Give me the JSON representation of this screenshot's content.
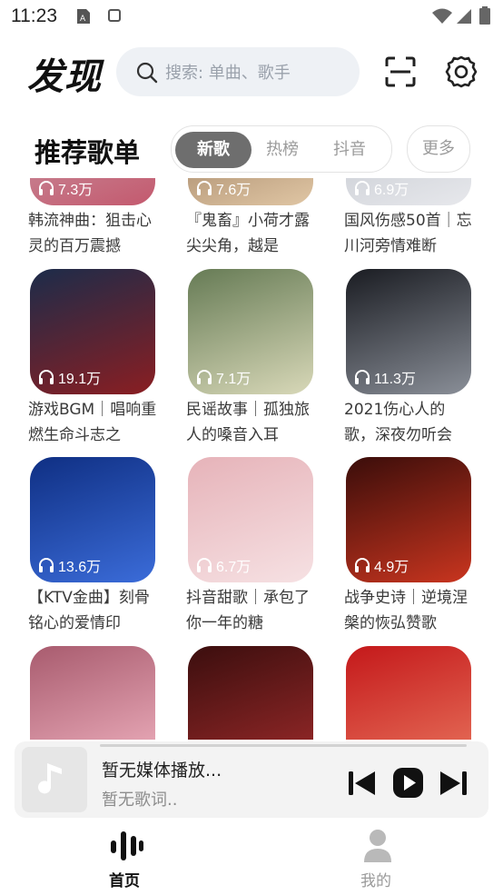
{
  "status_bar": {
    "time": "11:23"
  },
  "header": {
    "logo": "发现",
    "search_placeholder": "搜索: 单曲、歌手"
  },
  "section": {
    "title": "推荐歌单",
    "tabs": [
      "新歌",
      "热榜",
      "抖音"
    ],
    "active_tab": "新歌",
    "more": "更多"
  },
  "playlists": [
    {
      "count": "7.3万",
      "title": "韩流神曲：狙击心灵的百万震撼",
      "colors": [
        "#c8a7b1",
        "#c4596e"
      ]
    },
    {
      "count": "7.6万",
      "title": "『鬼畜』小荷才露尖尖角，越是",
      "colors": [
        "#8a6a4e",
        "#e0c6a4"
      ]
    },
    {
      "count": "6.9万",
      "title": "国风伤感50首｜忘川河旁情难断",
      "colors": [
        "#b9bec6",
        "#e7e8ec"
      ]
    },
    {
      "count": "19.1万",
      "title": "游戏BGM｜唱响重燃生命斗志之",
      "colors": [
        "#1c2c4a",
        "#8a1e22"
      ]
    },
    {
      "count": "7.1万",
      "title": "民谣故事｜孤独旅人的嗓音入耳",
      "colors": [
        "#667b55",
        "#d8d8b8"
      ]
    },
    {
      "count": "11.3万",
      "title": "2021伤心人的歌，深夜勿听会",
      "colors": [
        "#1a1c22",
        "#8a8f98"
      ]
    },
    {
      "count": "13.6万",
      "title": "【KTV金曲】刻骨铭心的爱情印",
      "colors": [
        "#0f2f83",
        "#3b6cd9"
      ]
    },
    {
      "count": "6.7万",
      "title": "抖音甜歌｜承包了你一年的糖",
      "colors": [
        "#e6b3b9",
        "#f6e1e3"
      ]
    },
    {
      "count": "4.9万",
      "title": "战争史诗｜逆境涅槃的恢弘赞歌",
      "colors": [
        "#3a0d0a",
        "#c9351f"
      ]
    },
    {
      "count": "",
      "title": "",
      "colors": [
        "#a85b6e",
        "#f0b2c0"
      ]
    },
    {
      "count": "",
      "title": "",
      "colors": [
        "#3b0e0e",
        "#9c2a2a"
      ]
    },
    {
      "count": "",
      "title": "",
      "colors": [
        "#c4181a",
        "#e8745d"
      ]
    }
  ],
  "player": {
    "title": "暂无媒体播放...",
    "lyrics": "暂无歌词.."
  },
  "nav": {
    "home": "首页",
    "mine": "我的"
  },
  "icons": {
    "headphone": "headphone-icon",
    "scan": "scan-icon",
    "settings": "settings-gear-icon",
    "search": "search-icon",
    "music_note": "music-note-icon",
    "previous": "previous-icon",
    "play": "play-icon",
    "next": "next-icon",
    "home": "sound-bars-icon",
    "mine": "user-icon"
  }
}
